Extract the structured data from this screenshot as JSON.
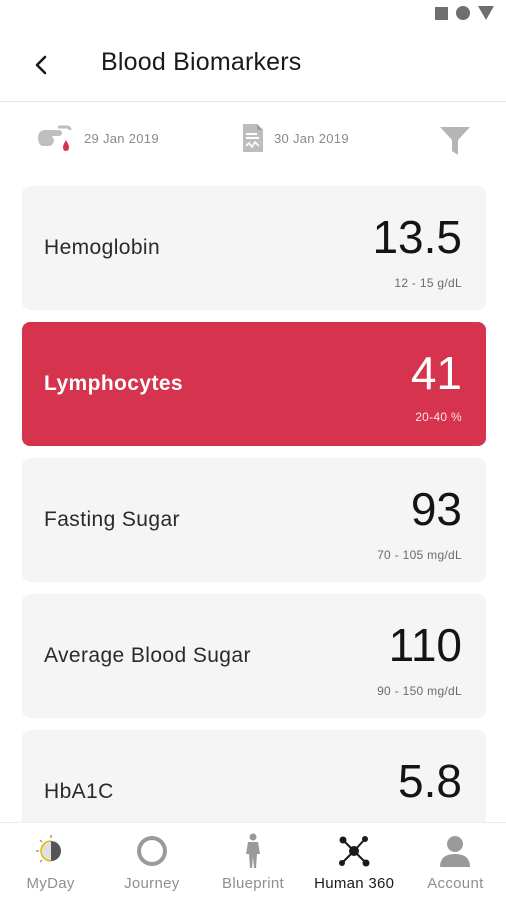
{
  "header": {
    "title": "Blood Biomarkers",
    "back_icon": "chevron-left-icon"
  },
  "dates": {
    "collected": "29 Jan 2019",
    "collected_icon": "blood-drop-hand-icon",
    "reported": "30 Jan 2019",
    "reported_icon": "report-document-icon",
    "filter_icon": "filter-icon"
  },
  "biomarkers": [
    {
      "name": "Hemoglobin",
      "value": "13.5",
      "range": "12 - 15 g/dL",
      "status": "normal"
    },
    {
      "name": "Lymphocytes",
      "value": "41",
      "range": "20-40 %",
      "status": "alert"
    },
    {
      "name": "Fasting Sugar",
      "value": "93",
      "range": "70 - 105 mg/dL",
      "status": "normal"
    },
    {
      "name": "Average Blood Sugar",
      "value": "110",
      "range": "90 - 150 mg/dL",
      "status": "normal"
    },
    {
      "name": "HbA1C",
      "value": "5.8",
      "range": "",
      "status": "normal"
    }
  ],
  "tabs": [
    {
      "label": "MyDay",
      "icon": "day-night-icon",
      "active": false
    },
    {
      "label": "Journey",
      "icon": "compass-icon",
      "active": false
    },
    {
      "label": "Blueprint",
      "icon": "body-figure-icon",
      "active": false
    },
    {
      "label": "Human 360",
      "icon": "network-nodes-icon",
      "active": true
    },
    {
      "label": "Account",
      "icon": "user-icon",
      "active": false
    }
  ],
  "colors": {
    "alert": "#d6334e",
    "card_bg": "#f5f5f5",
    "icon_gray": "#8f8f8f"
  }
}
